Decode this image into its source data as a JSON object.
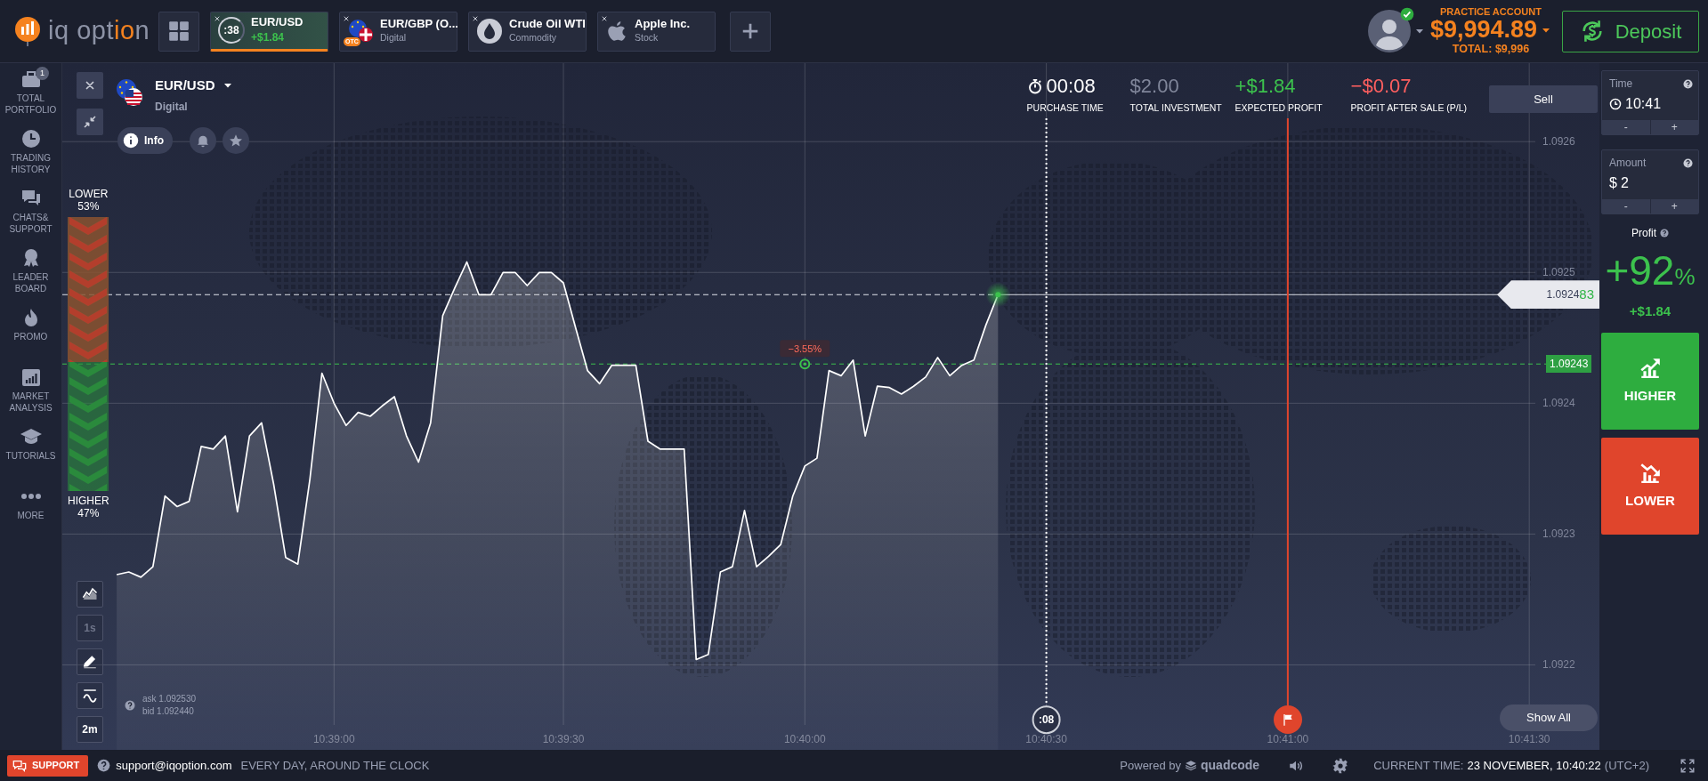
{
  "header": {
    "logo": {
      "text_start": "iq opt",
      "text_accent": "io",
      "text_end": "n"
    },
    "tabs": [
      {
        "title": "EUR/USD",
        "subtitle": "+$1.84",
        "timer": ":38",
        "kind": "forex",
        "selected": true
      },
      {
        "title": "EUR/GBP (O...",
        "subtitle": "Digital",
        "badge": "OTC",
        "kind": "otc",
        "selected": false
      },
      {
        "title": "Crude Oil WTI",
        "subtitle": "Commodity",
        "kind": "oil",
        "selected": false
      },
      {
        "title": "Apple Inc.",
        "subtitle": "Stock",
        "kind": "apple",
        "selected": false
      }
    ],
    "account": {
      "label": "PRACTICE ACCOUNT",
      "balance": "$9,994.89",
      "total": "TOTAL: $9,996",
      "verified": true
    },
    "deposit": "Deposit"
  },
  "sidebar": {
    "items": [
      {
        "label": "TOTAL PORTFOLIO",
        "kind": "portfolio",
        "badge": "1"
      },
      {
        "label": "TRADING HISTORY",
        "kind": "history"
      },
      {
        "label": "CHATS& SUPPORT",
        "kind": "chat"
      },
      {
        "label": "LEADER BOARD",
        "kind": "leader"
      },
      {
        "label": "PROMO",
        "kind": "promo"
      },
      {
        "label": "MARKET ANALYSIS",
        "kind": "analysis"
      },
      {
        "label": "TUTORIALS",
        "kind": "tutorials"
      },
      {
        "label": "MORE",
        "kind": "more"
      }
    ]
  },
  "chart": {
    "asset": {
      "name": "EUR/USD",
      "type": "Digital"
    },
    "info_button": "Info",
    "stats": [
      {
        "value": "00:08",
        "label": "PURCHASE TIME",
        "color": "#ffffff",
        "kind": "timer"
      },
      {
        "value": "$2.00",
        "label": "TOTAL INVESTMENT",
        "color": "#80869a",
        "kind": "plain"
      },
      {
        "value": "+$1.84",
        "label": "EXPECTED PROFIT",
        "color": "#3cc24d",
        "kind": "plain"
      },
      {
        "value": "−$0.07",
        "label": "PROFIT AFTER SALE (P/L)",
        "color": "#ff5f5f",
        "kind": "plain"
      }
    ],
    "sell_button": "Sell",
    "sentiment": {
      "lower_label": "LOWER",
      "lower_percent": "53%",
      "higher_label": "HIGHER",
      "higher_percent": "47%",
      "level": 0.53
    },
    "tools": [
      {
        "kind": "chart-type",
        "disabled": false
      },
      {
        "kind": "text",
        "label": "1s",
        "disabled": true
      },
      {
        "kind": "draw",
        "disabled": false
      },
      {
        "kind": "indicator",
        "disabled": false
      },
      {
        "kind": "text",
        "label": "2m",
        "disabled": false
      }
    ],
    "quote": {
      "ask": "ask 1.092530",
      "bid": "bid 1.092440"
    },
    "price_tag": {
      "main": "1.0924",
      "tail": "83"
    },
    "show_all": "Show All",
    "strike_label": "1.09243",
    "chart_data": {
      "type": "area",
      "grid": true,
      "categories": [
        null,
        null,
        null,
        null,
        null,
        null,
        null,
        null,
        null,
        null,
        null,
        null,
        null,
        null,
        null,
        null,
        null,
        null,
        null,
        null,
        "10:39:00",
        null,
        null,
        null,
        null,
        null,
        null,
        null,
        null,
        null,
        null,
        null,
        null,
        null,
        null,
        null,
        null,
        null,
        null,
        "10:39:30",
        null,
        null,
        null,
        null,
        null,
        null,
        null,
        null,
        null,
        null,
        null,
        null,
        null,
        null,
        null,
        null,
        null,
        null,
        null,
        "10:40:00",
        null,
        null,
        null,
        null,
        null,
        null,
        null,
        null,
        null,
        null,
        null,
        null,
        null,
        null,
        null,
        null,
        null,
        null,
        null,
        "10:40:30",
        null,
        null,
        null,
        null,
        null,
        null,
        null,
        null,
        null,
        null,
        null,
        null,
        null,
        null,
        null,
        null,
        null,
        null,
        null,
        "10:41:00",
        null,
        null,
        null,
        null,
        null,
        null,
        null,
        null,
        null,
        null,
        null,
        null,
        null,
        null,
        null,
        null,
        null,
        null,
        null,
        "10:41:30",
        null,
        null,
        null,
        null,
        null
      ],
      "series": [
        {
          "color": "#ffffff",
          "values": [
            null,
            null,
            1.092269,
            1.092271,
            1.092267,
            1.092275,
            1.092329,
            1.092321,
            1.092325,
            1.092367,
            1.092365,
            1.092375,
            1.092317,
            1.092375,
            1.092385,
            1.092338,
            1.092282,
            1.092277,
            1.092342,
            1.092423,
            1.0924,
            1.092383,
            1.092393,
            1.09239,
            1.092398,
            1.092405,
            1.092375,
            1.092355,
            1.092385,
            1.092467,
            1.092488,
            1.092508,
            1.092483,
            1.092483,
            1.0925,
            1.0925,
            1.09249,
            1.0925,
            1.0925,
            1.092492,
            1.092458,
            1.092425,
            1.092415,
            1.092429,
            1.092429,
            1.092429,
            1.092371,
            1.092365,
            1.092365,
            1.092365,
            1.092204,
            1.092208,
            1.092271,
            1.092275,
            1.092318,
            1.092275,
            1.092283,
            1.092292,
            1.092329,
            1.092352,
            1.092358,
            1.092425,
            1.092421,
            1.092433,
            1.092375,
            1.092413,
            1.092412,
            1.092407,
            1.092413,
            1.09242,
            1.092435,
            1.092421,
            1.092429,
            1.092433,
            1.09246,
            1.092483,
            null,
            null,
            null,
            null,
            null,
            null,
            null,
            null,
            null,
            null,
            null,
            null,
            null,
            null,
            null,
            null,
            null,
            null,
            null,
            null,
            null,
            null,
            null,
            null,
            null,
            null,
            null,
            null,
            null,
            null,
            null,
            null,
            null,
            null,
            null,
            null,
            null,
            null,
            null,
            null,
            null,
            null,
            null,
            null,
            null,
            null,
            null,
            null,
            null
          ]
        }
      ],
      "ylim": [
        1.092135,
        1.09266
      ],
      "yticks": [
        1.0922,
        1.0923,
        1.0924,
        1.0925,
        1.0926
      ],
      "annotations": [
        {
          "x": "10:40:00",
          "y": 1.09243,
          "text": "−3.55%"
        },
        {
          "x": "10:40:30",
          "y": 1.092158,
          "text": ":08"
        },
        {
          "x": "10:41:00"
        }
      ]
    }
  },
  "trade_panel": {
    "time": {
      "label": "Time",
      "value": "10:41",
      "decrease": "-",
      "increase": "+"
    },
    "amount": {
      "label": "Amount",
      "currency": "$",
      "value": "2",
      "decrease": "-",
      "increase": "+"
    },
    "profit": {
      "label": "Profit",
      "percent": "+92",
      "percent_sign": "%",
      "amount": "+$1.84"
    },
    "higher_button": "HIGHER",
    "lower_button": "LOWER"
  },
  "footer": {
    "support_button": "SUPPORT",
    "email": "support@iqoption.com",
    "hours": "EVERY DAY, AROUND THE CLOCK",
    "powered_prefix": "Powered by",
    "powered_brand": "quadcode",
    "time_label": "CURRENT TIME:",
    "time_value": "23 NOVEMBER, 10:40:22",
    "time_zone": "(UTC+2)"
  }
}
